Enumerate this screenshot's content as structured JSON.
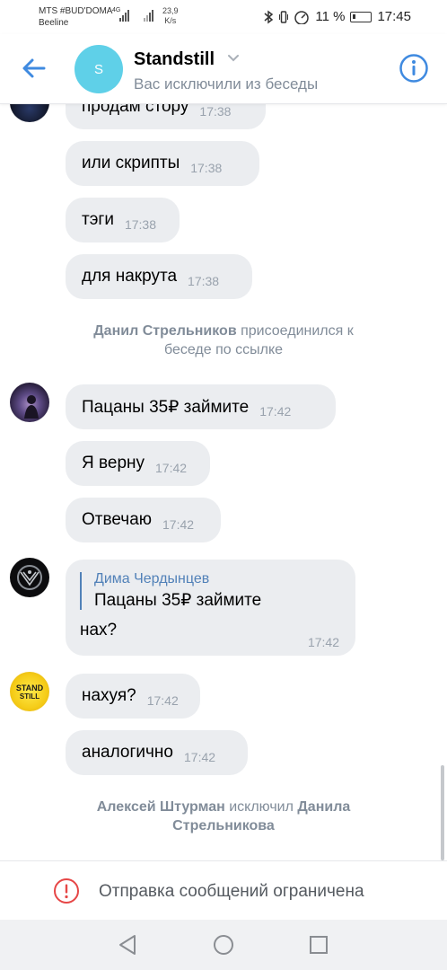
{
  "status_bar": {
    "carrier_primary": "MTS #BUD'DOMA",
    "carrier_secondary": "Beeline",
    "network_tag": "4G",
    "speed_value": "23,9",
    "speed_unit": "K/s",
    "battery_percent": "11 %",
    "time": "17:45"
  },
  "header": {
    "avatar_letter": "S",
    "title": "Standstill",
    "subtitle": "Вас исключили из беседы",
    "back_icon": "arrow-left-icon",
    "info_icon": "info-icon",
    "accent_color": "#3f8ae0"
  },
  "messages": [
    {
      "text": "продам стору",
      "time": "17:38"
    },
    {
      "text": "или скрипты",
      "time": "17:38"
    },
    {
      "text": "тэги",
      "time": "17:38"
    },
    {
      "text": "для накрута",
      "time": "17:38"
    },
    {
      "text": "Пацаны 35₽ займите",
      "time": "17:42"
    },
    {
      "text": "Я верну",
      "time": "17:42"
    },
    {
      "text": "Отвечаю",
      "time": "17:42"
    },
    {
      "text": "нахуя?",
      "time": "17:42"
    },
    {
      "text": "аналогично",
      "time": "17:42"
    }
  ],
  "system_joined": {
    "actor": "Данил Стрельников",
    "action_line1": " присоединился к",
    "action_line2": "беседе по ссылке"
  },
  "reply_message": {
    "quoted_author": "Дима Чердынцев",
    "quoted_text": "Пацаны 35₽ займите",
    "text": "нах?",
    "time": "17:42"
  },
  "standstill_avatar": {
    "line1": "STAND",
    "line2": "STILL"
  },
  "system_kicked": {
    "actor": "Алексей Штурман",
    "action": " исключил ",
    "target_line1": "Данила",
    "target_line2": "Стрельникова"
  },
  "restriction": {
    "text": "Отправка сообщений ограничена",
    "icon": "warning-circle-icon",
    "icon_color": "#e64646"
  },
  "navbar": {
    "back_icon": "triangle-back-icon",
    "home_icon": "circle-home-icon",
    "recents_icon": "square-recents-icon"
  }
}
